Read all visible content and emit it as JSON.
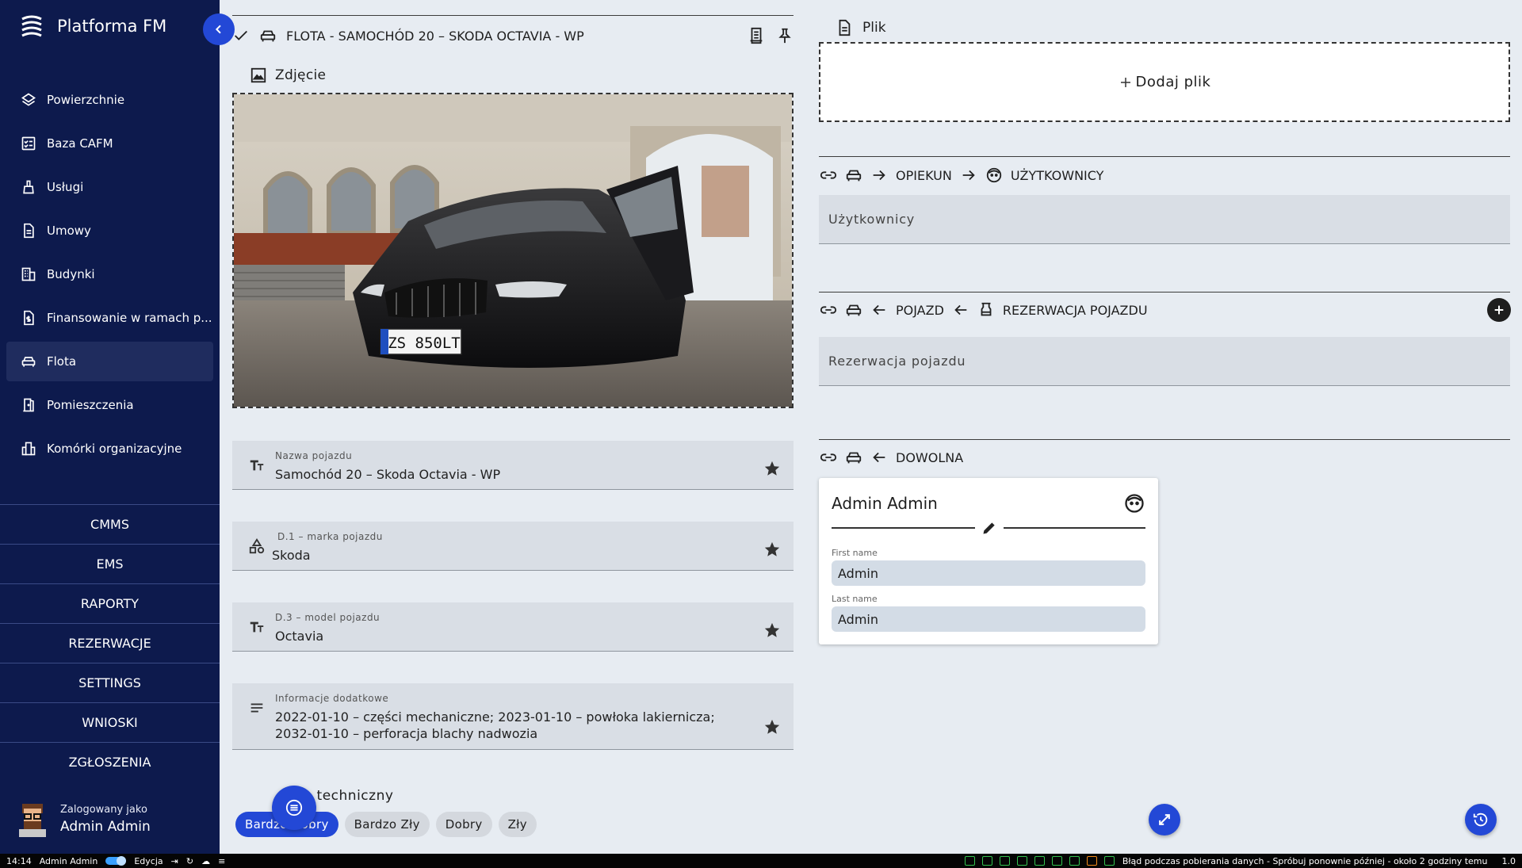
{
  "app": {
    "title": "Platforma FM"
  },
  "sidebar": {
    "items": [
      {
        "label": "Powierzchnie",
        "icon": "layers-icon"
      },
      {
        "label": "Baza CAFM",
        "icon": "checklist-icon"
      },
      {
        "label": "Usługi",
        "icon": "broom-icon"
      },
      {
        "label": "Umowy",
        "icon": "document-icon"
      },
      {
        "label": "Budynki",
        "icon": "building-icon"
      },
      {
        "label": "Finansowanie w ramach p...",
        "icon": "money-document-icon"
      },
      {
        "label": "Flota",
        "icon": "car-icon",
        "active": true
      },
      {
        "label": "Pomieszczenia",
        "icon": "door-icon"
      },
      {
        "label": "Komórki organizacyjne",
        "icon": "org-building-icon"
      }
    ],
    "groups": [
      "CMMS",
      "EMS",
      "RAPORTY",
      "REZERWACJE",
      "SETTINGS",
      "WNIOSKI",
      "ZGŁOSZENIA"
    ],
    "user": {
      "logged_as_label": "Zalogowany jako",
      "name": "Admin Admin"
    }
  },
  "record": {
    "title": "FLOTA - SAMOCHÓD 20 – SKODA OCTAVIA - WP",
    "photo_label": "Zdjęcie",
    "photo_plate": "ZS 850LT",
    "fields": [
      {
        "label": "Nazwa pojazdu",
        "value": "Samochód 20 – Skoda Octavia - WP",
        "icon": "text-format-icon"
      },
      {
        "label": "D.1 – marka pojazdu",
        "value": "Skoda",
        "icon": "shapes-icon"
      },
      {
        "label": "D.3 – model pojazdu",
        "value": "Octavia",
        "icon": "text-format-icon"
      },
      {
        "label": "Informacje dodatkowe",
        "value": "2022-01-10 – części mechaniczne; 2023-01-10 – powłoka lakiernicza; 2032-01-10 – perforacja blachy nadwozia",
        "icon": "notes-icon"
      }
    ],
    "condition": {
      "label": "Stan techniczny",
      "options": [
        "Bardzo Dobry",
        "Bardzo Zły",
        "Dobry",
        "Zły"
      ],
      "selected": "Bardzo Dobry"
    }
  },
  "right": {
    "file_label": "Plik",
    "add_file": "Dodaj plik",
    "relation1": {
      "from": "OPIEKUN",
      "to": "UŻYTKOWNICY",
      "field": "Użytkownicy"
    },
    "relation2": {
      "from": "POJAZD",
      "to": "REZERWACJA POJAZDU",
      "field": "Rezerwacja pojazdu"
    },
    "relation3": {
      "from": "DOWOLNA"
    },
    "card": {
      "title": "Admin Admin",
      "first_name_label": "First name",
      "first_name": "Admin",
      "last_name_label": "Last name",
      "last_name": "Admin"
    }
  },
  "statusbar": {
    "time": "14:14",
    "user": "Admin Admin",
    "mode": "Edycja",
    "message": "Błąd podczas pobierania danych - Spróbuj ponownie później - około 2 godziny temu",
    "version": "1.0"
  },
  "colors": {
    "sidebar": "#0d1a4d",
    "accent": "#2348d6",
    "background": "#e7ecf2"
  }
}
